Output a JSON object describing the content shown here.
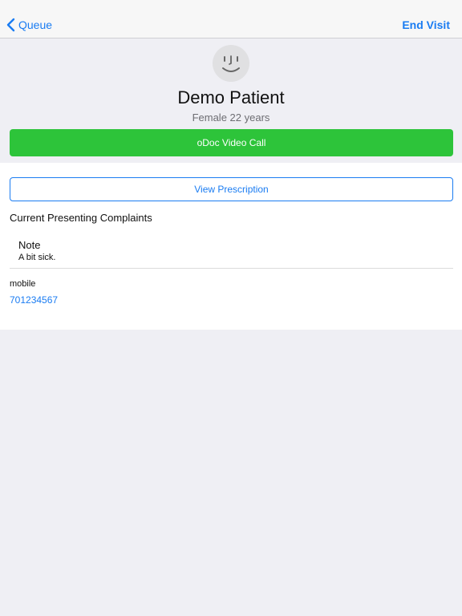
{
  "navbar": {
    "back_label": "Queue",
    "end_visit_label": "End Visit"
  },
  "patient": {
    "name": "Demo Patient",
    "details": "Female 22 years"
  },
  "actions": {
    "video_call_label": "oDoc Video Call",
    "prescription_label": "View Prescription"
  },
  "complaints": {
    "heading": "Current Presenting Complaints",
    "items": [
      {
        "title": "Note",
        "description": "A bit sick."
      }
    ]
  },
  "contact": {
    "label": "mobile",
    "value": "701234567"
  },
  "colors": {
    "accent": "#1a7cf2",
    "call_green": "#2dc43a",
    "background": "#efeff4"
  }
}
